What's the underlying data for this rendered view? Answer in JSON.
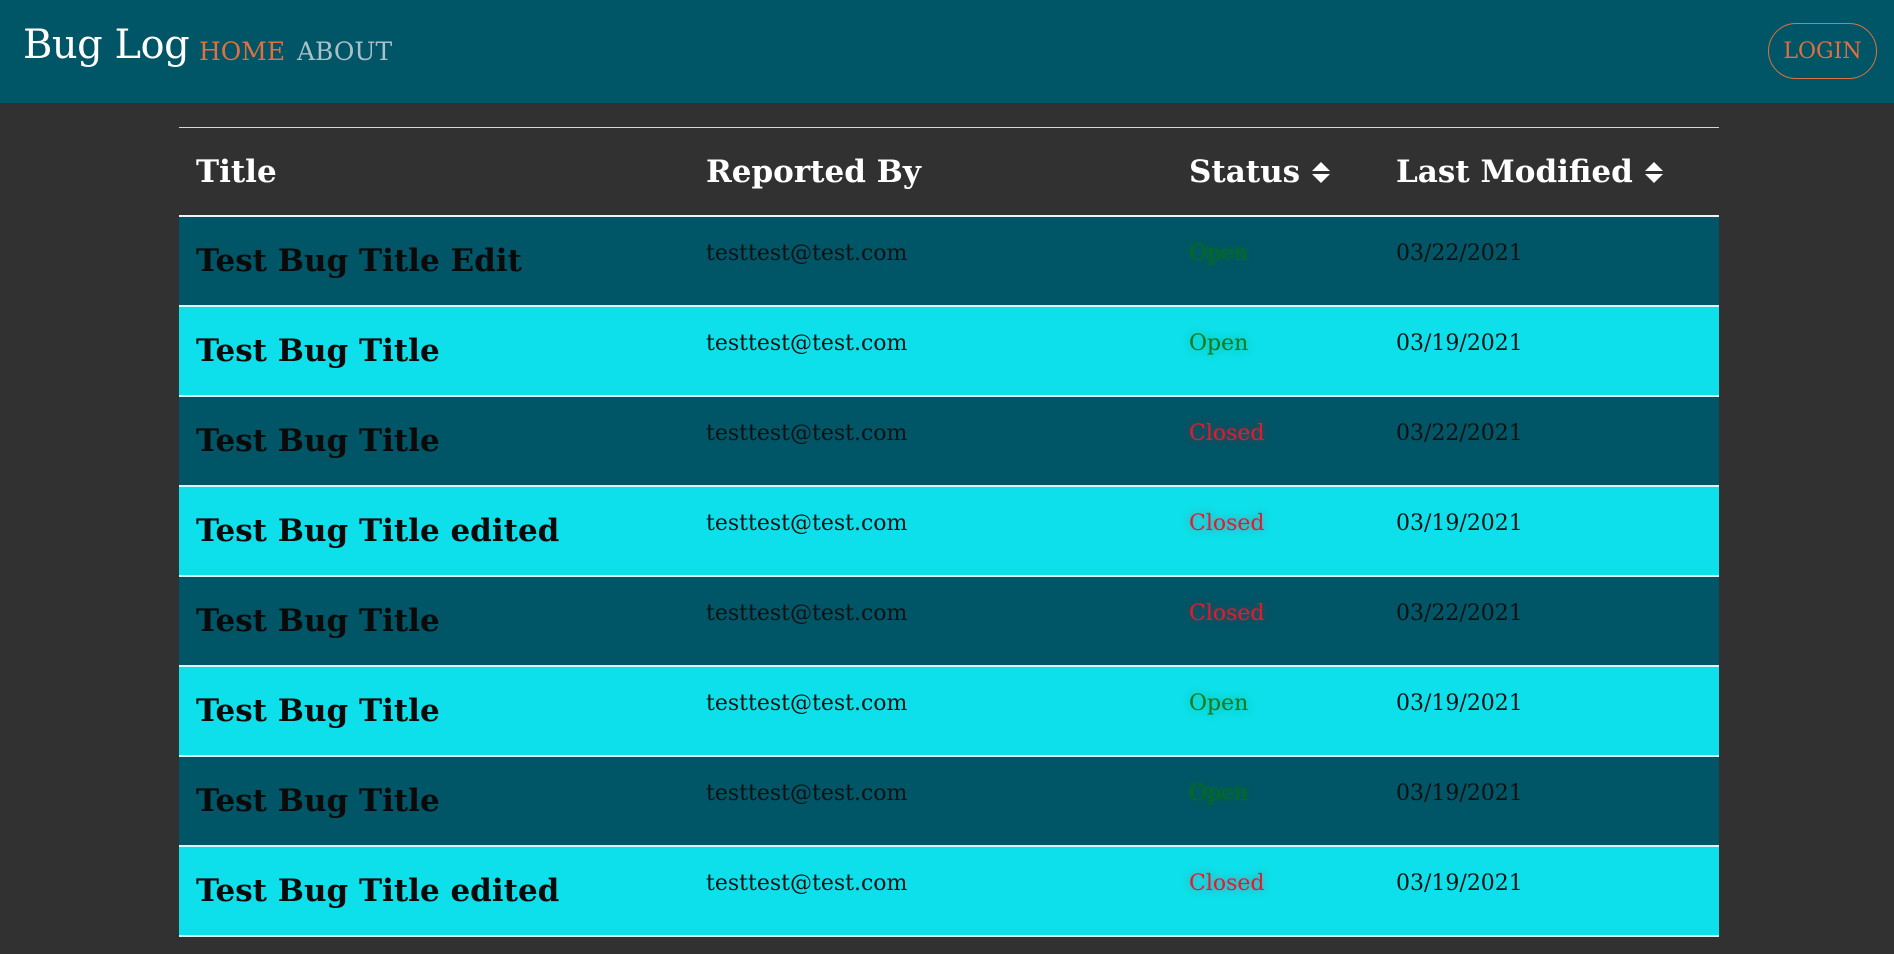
{
  "nav": {
    "brand": "Bug Log",
    "links": [
      {
        "label": "HOME",
        "active": true
      },
      {
        "label": "ABOUT",
        "active": false
      }
    ],
    "login_label": "LOGIN"
  },
  "colors": {
    "navbar_bg": "#005566",
    "page_bg": "#313131",
    "accent": "#e07040",
    "inactive_link": "#a9c1c8",
    "row_dark": "#005566",
    "row_light": "#0de0ea",
    "status_open": "#0b7a1a",
    "status_closed": "#e8192c"
  },
  "table": {
    "columns": [
      {
        "label": "Title",
        "sortable": false
      },
      {
        "label": "Reported By",
        "sortable": false
      },
      {
        "label": "Status",
        "sortable": true,
        "icon": "sort-icon"
      },
      {
        "label": "Last Modified",
        "sortable": true,
        "icon": "sort-icon"
      }
    ],
    "rows": [
      {
        "title": "Test Bug Title Edit",
        "reported_by": "testtest@test.com",
        "status": "Open",
        "last_modified": "03/22/2021"
      },
      {
        "title": "Test Bug Title",
        "reported_by": "testtest@test.com",
        "status": "Open",
        "last_modified": "03/19/2021"
      },
      {
        "title": "Test Bug Title",
        "reported_by": "testtest@test.com",
        "status": "Closed",
        "last_modified": "03/22/2021"
      },
      {
        "title": "Test Bug Title edited",
        "reported_by": "testtest@test.com",
        "status": "Closed",
        "last_modified": "03/19/2021"
      },
      {
        "title": "Test Bug Title",
        "reported_by": "testtest@test.com",
        "status": "Closed",
        "last_modified": "03/22/2021"
      },
      {
        "title": "Test Bug Title",
        "reported_by": "testtest@test.com",
        "status": "Open",
        "last_modified": "03/19/2021"
      },
      {
        "title": "Test Bug Title",
        "reported_by": "testtest@test.com",
        "status": "Open",
        "last_modified": "03/19/2021"
      },
      {
        "title": "Test Bug Title edited",
        "reported_by": "testtest@test.com",
        "status": "Closed",
        "last_modified": "03/19/2021"
      }
    ]
  }
}
